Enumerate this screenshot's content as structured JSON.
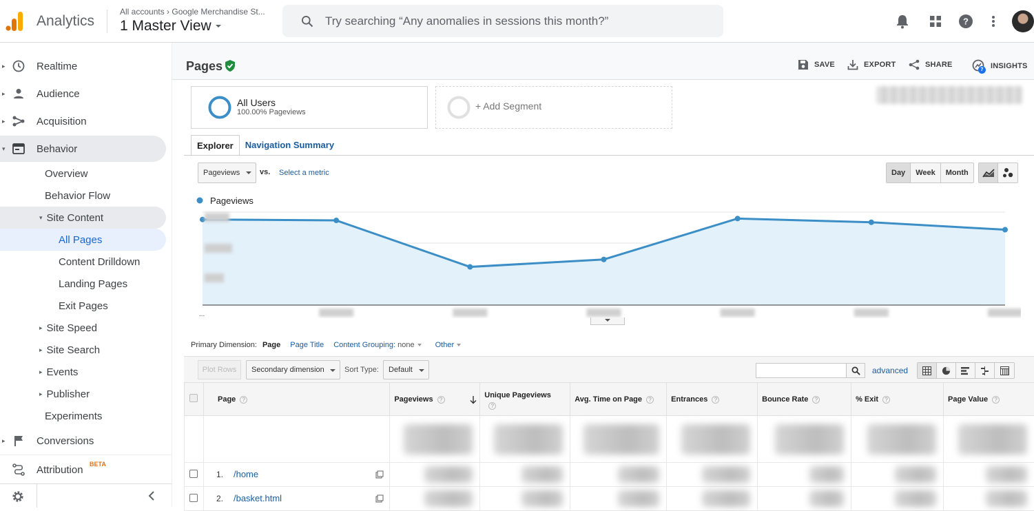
{
  "header": {
    "app_name": "Analytics",
    "account_path": "All accounts › Google Merchandise St...",
    "view_name": "1 Master View",
    "search_placeholder": "Try searching “Any anomalies in sessions this month?”",
    "icons": [
      "bell-icon",
      "apps-grid-icon",
      "help-icon",
      "more-vert-icon"
    ]
  },
  "sidebar": {
    "items": [
      {
        "label": "Realtime",
        "icon": "clock-icon"
      },
      {
        "label": "Audience",
        "icon": "person-icon"
      },
      {
        "label": "Acquisition",
        "icon": "acquisition-icon"
      },
      {
        "label": "Behavior",
        "icon": "behavior-icon"
      }
    ],
    "behavior_sub": {
      "overview": "Overview",
      "behavior_flow": "Behavior Flow",
      "site_content": "Site Content",
      "all_pages": "All Pages",
      "content_drilldown": "Content Drilldown",
      "landing_pages": "Landing Pages",
      "exit_pages": "Exit Pages",
      "site_speed": "Site Speed",
      "site_search": "Site Search",
      "events": "Events",
      "publisher": "Publisher",
      "experiments": "Experiments"
    },
    "conversions": "Conversions",
    "attribution": "Attribution",
    "attribution_badge": "BETA"
  },
  "page": {
    "title": "Pages",
    "actions": {
      "save": "SAVE",
      "export": "EXPORT",
      "share": "SHARE",
      "insights": "INSIGHTS",
      "insights_count": "7"
    }
  },
  "segments": {
    "primary_name": "All Users",
    "primary_sub": "100.00% Pageviews",
    "add_label": "+ Add Segment"
  },
  "tabs": {
    "explorer": "Explorer",
    "navigation_summary": "Navigation Summary"
  },
  "chart_controls": {
    "metric": "Pageviews",
    "vs": "vs.",
    "select_metric": "Select a metric",
    "granularity": [
      "Day",
      "Week",
      "Month"
    ],
    "active_granularity": "Day"
  },
  "chart_data": {
    "type": "line",
    "series": [
      {
        "name": "Pageviews",
        "values": [
          0.98,
          0.97,
          0.47,
          0.55,
          0.99,
          0.95,
          0.87
        ]
      }
    ],
    "x": [
      "",
      "",
      "",
      "",
      "",
      "",
      ""
    ],
    "x_first_label": "...",
    "note": "y-axis tick labels and x-axis dates are blurred in the screenshot; values are relative heights",
    "ylim": [
      0,
      1
    ],
    "grid": true,
    "color": "#3b8ec6",
    "fill": "#e3f1fa"
  },
  "dimensions": {
    "label": "Primary Dimension:",
    "active": "Page",
    "page_title": "Page Title",
    "content_grouping": "Content Grouping:",
    "content_grouping_value": "none",
    "other": "Other"
  },
  "table_toolbar": {
    "plot_rows": "Plot Rows",
    "secondary_dimension": "Secondary dimension",
    "sort_type_label": "Sort Type:",
    "sort_type_value": "Default",
    "advanced": "advanced"
  },
  "table": {
    "columns": [
      "Page",
      "Pageviews",
      "Unique Pageviews",
      "Avg. Time on Page",
      "Entrances",
      "Bounce Rate",
      "% Exit",
      "Page Value"
    ],
    "rows": [
      {
        "index": "1.",
        "page": "/home"
      },
      {
        "index": "2.",
        "page": "/basket.html"
      }
    ]
  }
}
